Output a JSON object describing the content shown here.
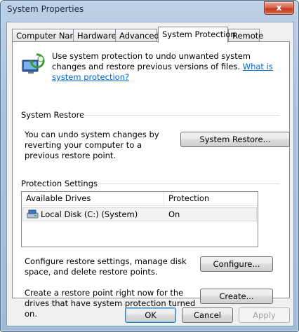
{
  "window": {
    "title": "System Properties",
    "close_glyph": "x"
  },
  "tabs": [
    {
      "label": "Computer Name",
      "active": false
    },
    {
      "label": "Hardware",
      "active": false
    },
    {
      "label": "Advanced",
      "active": false
    },
    {
      "label": "System Protection",
      "active": true
    },
    {
      "label": "Remote",
      "active": false
    }
  ],
  "intro": {
    "icon": "system-protection-icon",
    "text": "Use system protection to undo unwanted system changes and restore previous versions of files.",
    "link": "What is system protection?"
  },
  "system_restore": {
    "title": "System Restore",
    "description": "You can undo system changes by reverting your computer to a previous restore point.",
    "button": "System Restore..."
  },
  "protection_settings": {
    "title": "Protection Settings",
    "columns": [
      "Available Drives",
      "Protection"
    ],
    "rows": [
      {
        "icon": "local-disk-icon",
        "drive": "Local Disk (C:) (System)",
        "protection": "On"
      }
    ],
    "configure_text": "Configure restore settings, manage disk space, and delete restore points.",
    "configure_button": "Configure...",
    "create_text": "Create a restore point right now for the drives that have system protection turned on.",
    "create_button": "Create..."
  },
  "footer": {
    "ok": "OK",
    "cancel": "Cancel",
    "apply": "Apply"
  },
  "colors": {
    "link": "#0066cc",
    "close": "#c2391c"
  }
}
